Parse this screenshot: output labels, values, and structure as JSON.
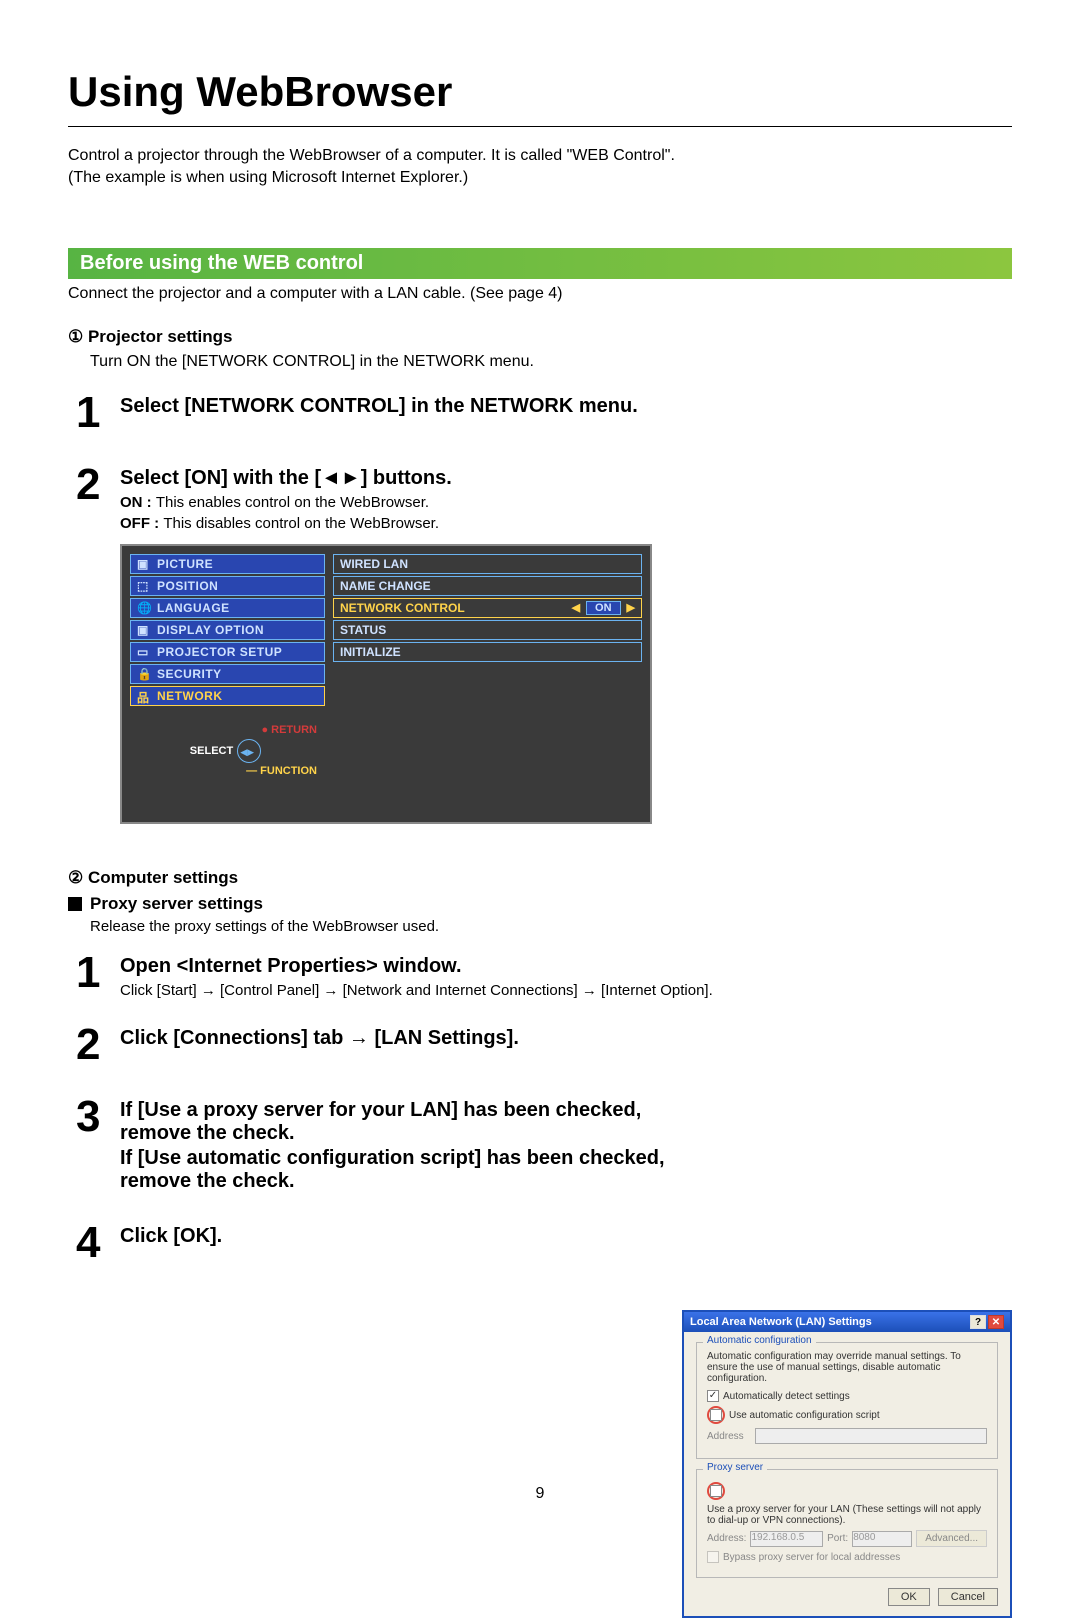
{
  "title": "Using WebBrowser",
  "intro_line1": "Control a projector through the WebBrowser of a computer. It is called \"WEB Control\".",
  "intro_line2": "(The example is when using Microsoft Internet Explorer.)",
  "section_heading": "Before using the WEB control",
  "section_intro": "Connect the projector and a computer with a LAN cable. (See page 4)",
  "projector": {
    "heading": "① Projector settings",
    "sub": "Turn ON the [NETWORK CONTROL] in the NETWORK menu.",
    "step1_title": "Select [NETWORK CONTROL] in the NETWORK menu.",
    "step2_title": "Select [ON] with the [◄►] buttons.",
    "step2_on": "ON : ",
    "step2_on_desc": "This enables control on the WebBrowser.",
    "step2_off": "OFF : ",
    "step2_off_desc": "This disables control on the WebBrowser."
  },
  "menu": {
    "left": [
      "PICTURE",
      "POSITION",
      "LANGUAGE",
      "DISPLAY OPTION",
      "PROJECTOR SETUP",
      "SECURITY",
      "NETWORK"
    ],
    "left_selected_index": 6,
    "footer_return": "● RETURN",
    "footer_select": "SELECT",
    "footer_function": "— FUNCTION",
    "right": [
      "WIRED LAN",
      "NAME CHANGE",
      "NETWORK CONTROL",
      "STATUS",
      "INITIALIZE"
    ],
    "right_active_index": 2,
    "on_label": "ON"
  },
  "computer": {
    "heading": "② Computer settings",
    "proxy_heading": "Proxy server settings",
    "proxy_sub": "Release the proxy settings of the WebBrowser used.",
    "step1_title": "Open <Internet Properties> window.",
    "step1_sub": "Click [Start] → [Control Panel] → [Network and Internet Connections] → [Internet Option].",
    "step2_title": "Click [Connections] tab → [LAN Settings].",
    "step3_line1": "If [Use a proxy server for your LAN] has been checked, remove the check.",
    "step3_line2": "If [Use automatic configuration script] has been checked, remove the check.",
    "step4_title": "Click [OK]."
  },
  "lan_dialog": {
    "title": "Local Area Network (LAN) Settings",
    "auto_legend": "Automatic configuration",
    "auto_note": "Automatic configuration may override manual settings. To ensure the use of manual settings, disable automatic configuration.",
    "auto_detect": "Automatically detect settings",
    "auto_script": "Use automatic configuration script",
    "address_label": "Address",
    "proxy_legend": "Proxy server",
    "proxy_use": "Use a proxy server for your LAN (These settings will not apply to dial-up or VPN connections).",
    "addr_label": "Address:",
    "addr_value": "192.168.0.5",
    "port_label": "Port:",
    "port_value": "8080",
    "advanced": "Advanced...",
    "bypass": "Bypass proxy server for local addresses",
    "ok": "OK",
    "cancel": "Cancel"
  },
  "page_number": "9"
}
